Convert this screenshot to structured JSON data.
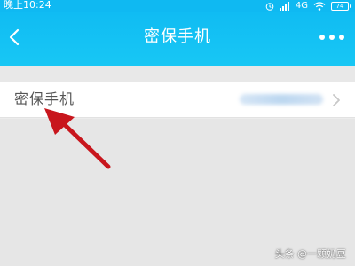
{
  "status_bar": {
    "time": "晚上10:24",
    "network": "4G",
    "battery": "74",
    "icons": [
      "alarm-icon",
      "signal-icon",
      "wifi-icon",
      "battery-icon"
    ]
  },
  "header": {
    "title": "密保手机",
    "back_icon": "chevron-left-icon",
    "more_icon": "more-dots-icon"
  },
  "settings": {
    "row_label": "密保手机",
    "row_value": "",
    "row_icon": "chevron-right-icon"
  },
  "watermark": "头条 @一颗奶豆",
  "colors": {
    "header": "#10bcf3",
    "arrow": "#c8161d",
    "background": "#e6e6e6"
  }
}
